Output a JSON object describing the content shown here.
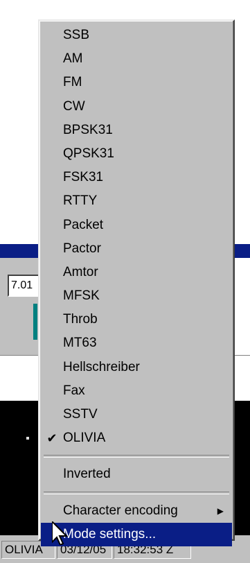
{
  "app": {
    "frequency_value": "7.01",
    "status": {
      "mode": "OLIVIA",
      "date": "03/12/05",
      "time": "18:32:53 Z"
    }
  },
  "menu": {
    "modes": [
      {
        "label": "SSB",
        "checked": false
      },
      {
        "label": "AM",
        "checked": false
      },
      {
        "label": "FM",
        "checked": false
      },
      {
        "label": "CW",
        "checked": false
      },
      {
        "label": "BPSK31",
        "checked": false
      },
      {
        "label": "QPSK31",
        "checked": false
      },
      {
        "label": "FSK31",
        "checked": false
      },
      {
        "label": "RTTY",
        "checked": false
      },
      {
        "label": "Packet",
        "checked": false
      },
      {
        "label": "Pactor",
        "checked": false
      },
      {
        "label": "Amtor",
        "checked": false
      },
      {
        "label": "MFSK",
        "checked": false
      },
      {
        "label": "Throb",
        "checked": false
      },
      {
        "label": "MT63",
        "checked": false
      },
      {
        "label": "Hellschreiber",
        "checked": false
      },
      {
        "label": "Fax",
        "checked": false
      },
      {
        "label": "SSTV",
        "checked": false
      },
      {
        "label": "OLIVIA",
        "checked": true
      }
    ],
    "check_glyph": "✔",
    "inverted_label": "Inverted",
    "character_encoding_label": "Character encoding",
    "submenu_arrow_glyph": "▶",
    "mode_settings_label": "Mode settings...",
    "highlight_color": "#0a1e86"
  }
}
